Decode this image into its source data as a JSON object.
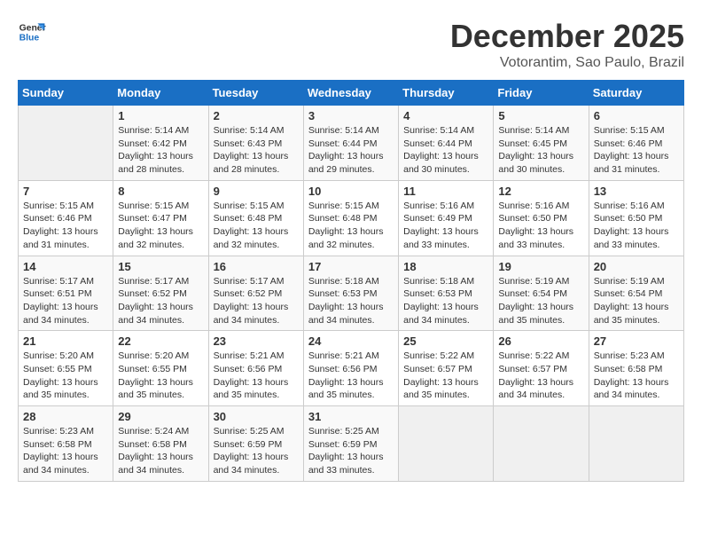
{
  "logo": {
    "line1": "General",
    "line2": "Blue"
  },
  "title": "December 2025",
  "subtitle": "Votorantim, Sao Paulo, Brazil",
  "days_of_week": [
    "Sunday",
    "Monday",
    "Tuesday",
    "Wednesday",
    "Thursday",
    "Friday",
    "Saturday"
  ],
  "weeks": [
    [
      {
        "num": "",
        "info": ""
      },
      {
        "num": "1",
        "info": "Sunrise: 5:14 AM\nSunset: 6:42 PM\nDaylight: 13 hours\nand 28 minutes."
      },
      {
        "num": "2",
        "info": "Sunrise: 5:14 AM\nSunset: 6:43 PM\nDaylight: 13 hours\nand 28 minutes."
      },
      {
        "num": "3",
        "info": "Sunrise: 5:14 AM\nSunset: 6:44 PM\nDaylight: 13 hours\nand 29 minutes."
      },
      {
        "num": "4",
        "info": "Sunrise: 5:14 AM\nSunset: 6:44 PM\nDaylight: 13 hours\nand 30 minutes."
      },
      {
        "num": "5",
        "info": "Sunrise: 5:14 AM\nSunset: 6:45 PM\nDaylight: 13 hours\nand 30 minutes."
      },
      {
        "num": "6",
        "info": "Sunrise: 5:15 AM\nSunset: 6:46 PM\nDaylight: 13 hours\nand 31 minutes."
      }
    ],
    [
      {
        "num": "7",
        "info": "Sunrise: 5:15 AM\nSunset: 6:46 PM\nDaylight: 13 hours\nand 31 minutes."
      },
      {
        "num": "8",
        "info": "Sunrise: 5:15 AM\nSunset: 6:47 PM\nDaylight: 13 hours\nand 32 minutes."
      },
      {
        "num": "9",
        "info": "Sunrise: 5:15 AM\nSunset: 6:48 PM\nDaylight: 13 hours\nand 32 minutes."
      },
      {
        "num": "10",
        "info": "Sunrise: 5:15 AM\nSunset: 6:48 PM\nDaylight: 13 hours\nand 32 minutes."
      },
      {
        "num": "11",
        "info": "Sunrise: 5:16 AM\nSunset: 6:49 PM\nDaylight: 13 hours\nand 33 minutes."
      },
      {
        "num": "12",
        "info": "Sunrise: 5:16 AM\nSunset: 6:50 PM\nDaylight: 13 hours\nand 33 minutes."
      },
      {
        "num": "13",
        "info": "Sunrise: 5:16 AM\nSunset: 6:50 PM\nDaylight: 13 hours\nand 33 minutes."
      }
    ],
    [
      {
        "num": "14",
        "info": "Sunrise: 5:17 AM\nSunset: 6:51 PM\nDaylight: 13 hours\nand 34 minutes."
      },
      {
        "num": "15",
        "info": "Sunrise: 5:17 AM\nSunset: 6:52 PM\nDaylight: 13 hours\nand 34 minutes."
      },
      {
        "num": "16",
        "info": "Sunrise: 5:17 AM\nSunset: 6:52 PM\nDaylight: 13 hours\nand 34 minutes."
      },
      {
        "num": "17",
        "info": "Sunrise: 5:18 AM\nSunset: 6:53 PM\nDaylight: 13 hours\nand 34 minutes."
      },
      {
        "num": "18",
        "info": "Sunrise: 5:18 AM\nSunset: 6:53 PM\nDaylight: 13 hours\nand 34 minutes."
      },
      {
        "num": "19",
        "info": "Sunrise: 5:19 AM\nSunset: 6:54 PM\nDaylight: 13 hours\nand 35 minutes."
      },
      {
        "num": "20",
        "info": "Sunrise: 5:19 AM\nSunset: 6:54 PM\nDaylight: 13 hours\nand 35 minutes."
      }
    ],
    [
      {
        "num": "21",
        "info": "Sunrise: 5:20 AM\nSunset: 6:55 PM\nDaylight: 13 hours\nand 35 minutes."
      },
      {
        "num": "22",
        "info": "Sunrise: 5:20 AM\nSunset: 6:55 PM\nDaylight: 13 hours\nand 35 minutes."
      },
      {
        "num": "23",
        "info": "Sunrise: 5:21 AM\nSunset: 6:56 PM\nDaylight: 13 hours\nand 35 minutes."
      },
      {
        "num": "24",
        "info": "Sunrise: 5:21 AM\nSunset: 6:56 PM\nDaylight: 13 hours\nand 35 minutes."
      },
      {
        "num": "25",
        "info": "Sunrise: 5:22 AM\nSunset: 6:57 PM\nDaylight: 13 hours\nand 35 minutes."
      },
      {
        "num": "26",
        "info": "Sunrise: 5:22 AM\nSunset: 6:57 PM\nDaylight: 13 hours\nand 34 minutes."
      },
      {
        "num": "27",
        "info": "Sunrise: 5:23 AM\nSunset: 6:58 PM\nDaylight: 13 hours\nand 34 minutes."
      }
    ],
    [
      {
        "num": "28",
        "info": "Sunrise: 5:23 AM\nSunset: 6:58 PM\nDaylight: 13 hours\nand 34 minutes."
      },
      {
        "num": "29",
        "info": "Sunrise: 5:24 AM\nSunset: 6:58 PM\nDaylight: 13 hours\nand 34 minutes."
      },
      {
        "num": "30",
        "info": "Sunrise: 5:25 AM\nSunset: 6:59 PM\nDaylight: 13 hours\nand 34 minutes."
      },
      {
        "num": "31",
        "info": "Sunrise: 5:25 AM\nSunset: 6:59 PM\nDaylight: 13 hours\nand 33 minutes."
      },
      {
        "num": "",
        "info": ""
      },
      {
        "num": "",
        "info": ""
      },
      {
        "num": "",
        "info": ""
      }
    ]
  ]
}
